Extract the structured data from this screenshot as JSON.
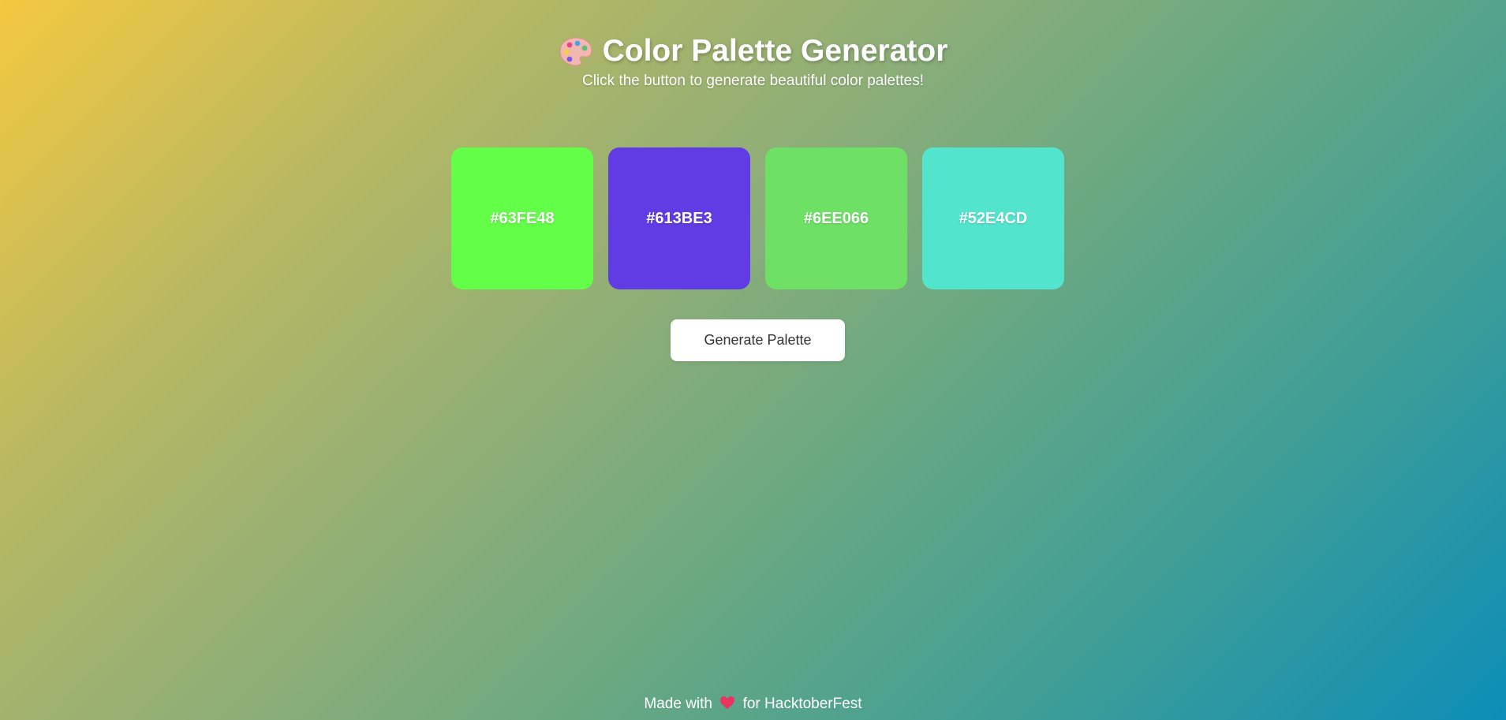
{
  "header": {
    "title": "Color Palette Generator",
    "title_icon": "palette-icon",
    "subtitle": "Click the button to generate beautiful color palettes!"
  },
  "palette": {
    "swatches": [
      {
        "label": "#63FE48",
        "color": "#63FE48"
      },
      {
        "label": "#613BE3",
        "color": "#613BE3"
      },
      {
        "label": "#6EE066",
        "color": "#6EE066"
      },
      {
        "label": "#52E4CD",
        "color": "#52E4CD"
      }
    ]
  },
  "actions": {
    "generate_label": "Generate Palette"
  },
  "footer": {
    "prefix": "Made with",
    "icon": "heart-icon",
    "suffix": "for HacktoberFest"
  },
  "colors": {
    "heart": "#e8345f",
    "button_text": "#333333"
  }
}
